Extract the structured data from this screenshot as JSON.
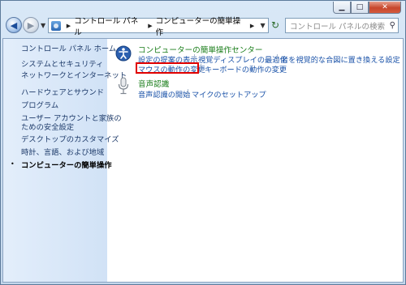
{
  "address": {
    "crumbs": [
      "コントロール パネル",
      "コンピューターの簡単操作"
    ]
  },
  "search": {
    "placeholder": "コントロール パネルの検索"
  },
  "sidebar": {
    "items": [
      "コントロール パネル ホーム",
      "システムとセキュリティ",
      "ネットワークとインターネット",
      "ハードウェアとサウンド",
      "プログラム",
      "ユーザー アカウントと家族の",
      "ための安全設定",
      "デスクトップのカスタマイズ",
      "時計、言語、および地域",
      "コンピューターの簡単操作"
    ],
    "bullet": "•"
  },
  "categories": {
    "ease": {
      "title": "コンピューターの簡単操作センター",
      "links": [
        "設定の提案の表示",
        "視覚ディスプレイの最適化",
        "音を視覚的な合図に置き換える設定",
        "マウスの動作の変更",
        "キーボードの動作の変更"
      ]
    },
    "speech": {
      "title": "音声認識",
      "links": [
        "音声認識の開始",
        "マイクのセットアップ"
      ]
    }
  },
  "icons": {
    "back": "back-arrow-icon",
    "forward": "forward-arrow-icon",
    "refresh": "refresh-icon",
    "search": "magnifier-icon",
    "ease": "ease-of-access-icon",
    "speech": "microphone-icon"
  },
  "colors": {
    "highlight": "#e00000",
    "category_title": "#1b7e1b",
    "link": "#1a52a8"
  }
}
